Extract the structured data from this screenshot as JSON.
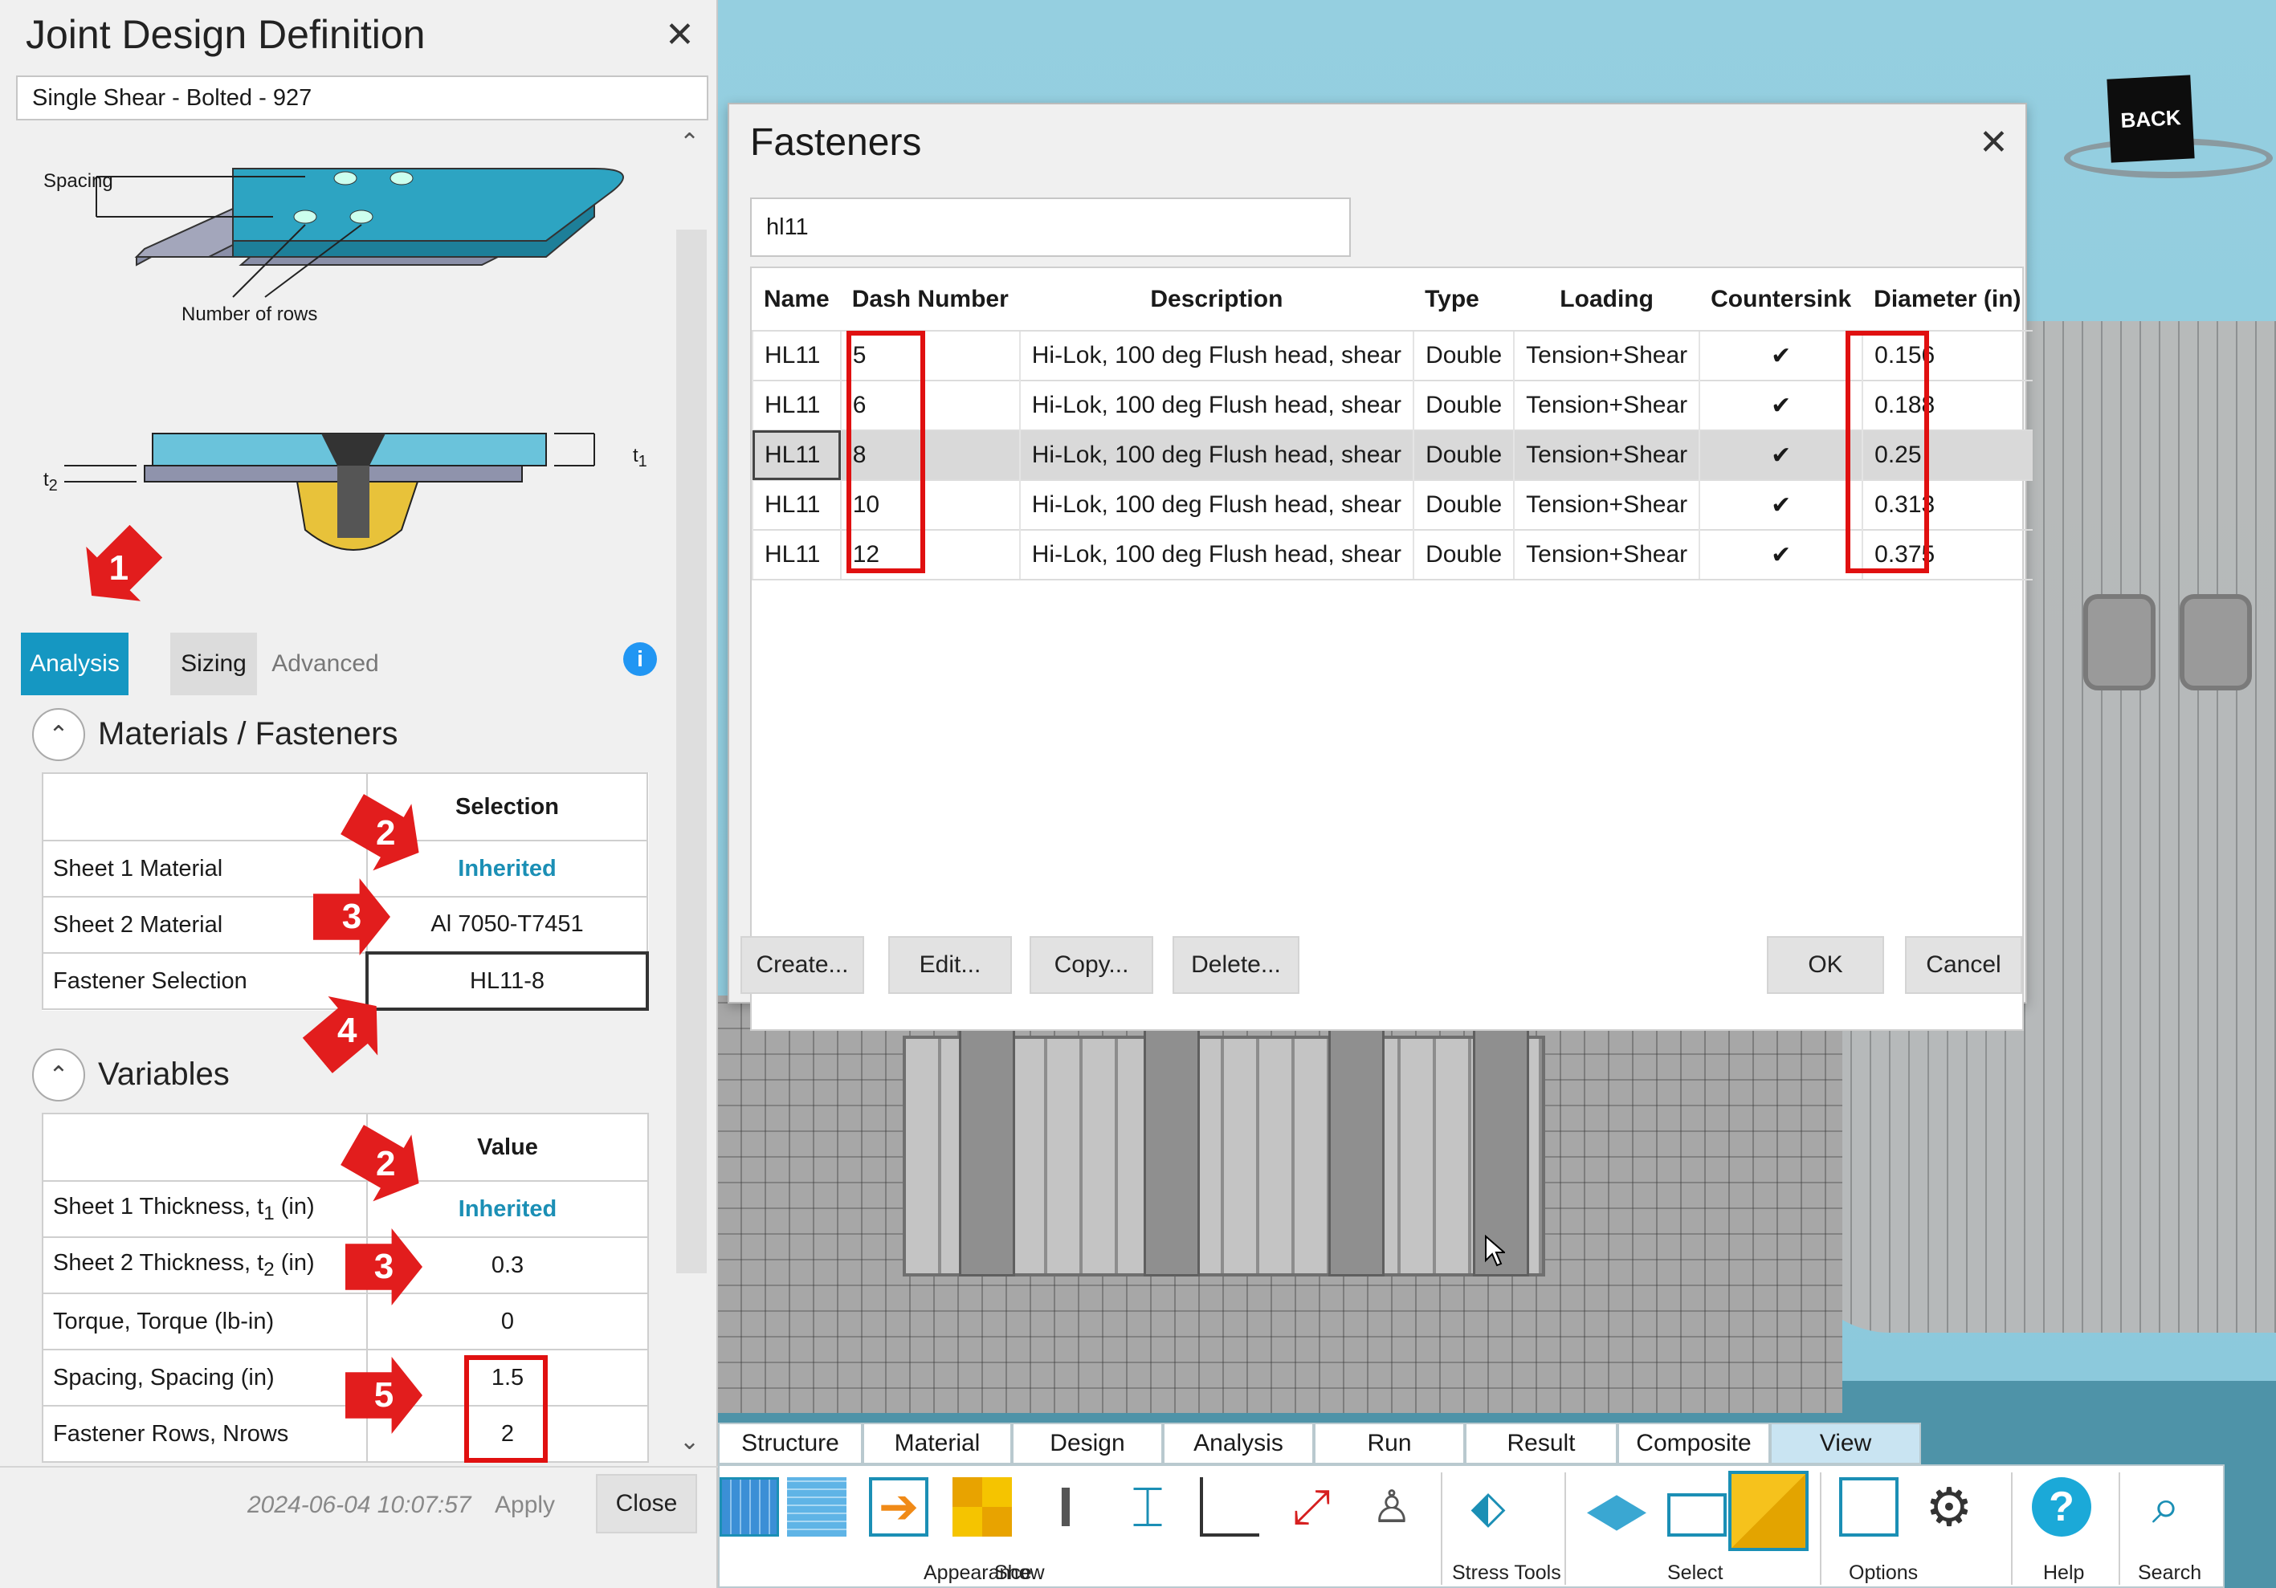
{
  "joint_panel": {
    "title": "Joint Design Definition",
    "name_value": "Single Shear - Bolted - 927",
    "diagram_labels": {
      "spacing": "Spacing",
      "rows": "Number of rows",
      "t1": "t",
      "t1_sub": "1",
      "t2": "t",
      "t2_sub": "2"
    },
    "tabs": [
      "Analysis",
      "Sizing",
      "Advanced"
    ],
    "info_icon": "info-icon",
    "materials_section": {
      "title": "Materials / Fasteners",
      "header": "Selection",
      "rows": [
        {
          "label": "Sheet 1 Material",
          "value": "Inherited"
        },
        {
          "label": "Sheet 2 Material",
          "value": "Al 7050-T7451"
        },
        {
          "label": "Fastener Selection",
          "value": "HL11-8"
        }
      ]
    },
    "variables_section": {
      "title": "Variables",
      "header": "Value",
      "rows": [
        {
          "label": "Sheet 1 Thickness, t",
          "sub": "1",
          "suffix": " (in)",
          "value": "Inherited"
        },
        {
          "label": "Sheet 2 Thickness, t",
          "sub": "2",
          "suffix": " (in)",
          "value": "0.3"
        },
        {
          "label": "Torque, Torque (lb-in)",
          "sub": "",
          "suffix": "",
          "value": "0"
        },
        {
          "label": "Spacing, Spacing (in)",
          "sub": "",
          "suffix": "",
          "value": "1.5"
        },
        {
          "label": "Fastener Rows, Nrows",
          "sub": "",
          "suffix": "",
          "value": "2"
        }
      ]
    },
    "timestamp": "2024-06-04 10:07:57",
    "apply_label": "Apply",
    "close_label": "Close",
    "annotations": [
      "1",
      "2",
      "3",
      "4",
      "2",
      "3",
      "5"
    ]
  },
  "fasteners_dialog": {
    "title": "Fasteners",
    "search_value": "hl11",
    "columns": [
      "Name",
      "Dash Number",
      "Description",
      "Type",
      "Loading",
      "Countersink",
      "Diameter (in)"
    ],
    "rows": [
      {
        "name": "HL11",
        "dash": "5",
        "desc": "Hi-Lok, 100 deg Flush head, shear",
        "type": "Double",
        "loading": "Tension+Shear",
        "countersink": "✔",
        "diameter": "0.156"
      },
      {
        "name": "HL11",
        "dash": "6",
        "desc": "Hi-Lok, 100 deg Flush head, shear",
        "type": "Double",
        "loading": "Tension+Shear",
        "countersink": "✔",
        "diameter": "0.188"
      },
      {
        "name": "HL11",
        "dash": "8",
        "desc": "Hi-Lok, 100 deg Flush head, shear",
        "type": "Double",
        "loading": "Tension+Shear",
        "countersink": "✔",
        "diameter": "0.25"
      },
      {
        "name": "HL11",
        "dash": "10",
        "desc": "Hi-Lok, 100 deg Flush head, shear",
        "type": "Double",
        "loading": "Tension+Shear",
        "countersink": "✔",
        "diameter": "0.313"
      },
      {
        "name": "HL11",
        "dash": "12",
        "desc": "Hi-Lok, 100 deg Flush head, shear",
        "type": "Double",
        "loading": "Tension+Shear",
        "countersink": "✔",
        "diameter": "0.375"
      }
    ],
    "selected_row": 2,
    "buttons": {
      "create": "Create...",
      "edit": "Edit...",
      "copy": "Copy...",
      "delete": "Delete...",
      "ok": "OK",
      "cancel": "Cancel"
    }
  },
  "viewport": {
    "back_label": "BACK"
  },
  "toolbar": {
    "tabs": [
      "Structure",
      "Material",
      "Design",
      "Analysis",
      "Run",
      "Result",
      "Composite",
      "View"
    ],
    "active_tab": "View",
    "groups": {
      "appearance": "Appearance",
      "show": "Show",
      "stress_tools": "Stress Tools",
      "select": "Select",
      "options": "Options",
      "help": "Help",
      "search": "Search"
    }
  },
  "colors": {
    "accent": "#1b8fb5",
    "annotation_red": "#e01010",
    "active_tab_bg": "#1597c2"
  }
}
